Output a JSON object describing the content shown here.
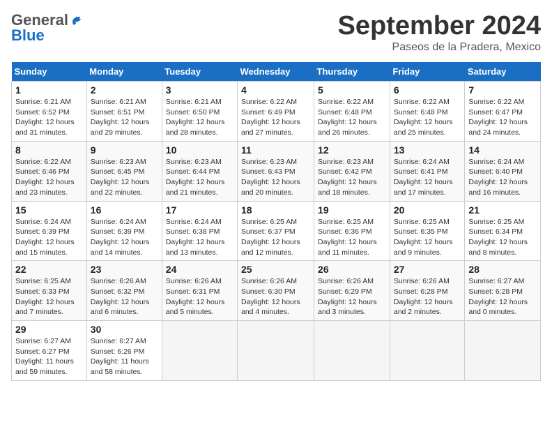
{
  "logo": {
    "general": "General",
    "blue": "Blue"
  },
  "header": {
    "month": "September 2024",
    "location": "Paseos de la Pradera, Mexico"
  },
  "weekdays": [
    "Sunday",
    "Monday",
    "Tuesday",
    "Wednesday",
    "Thursday",
    "Friday",
    "Saturday"
  ],
  "weeks": [
    [
      {
        "day": "1",
        "detail": "Sunrise: 6:21 AM\nSunset: 6:52 PM\nDaylight: 12 hours\nand 31 minutes."
      },
      {
        "day": "2",
        "detail": "Sunrise: 6:21 AM\nSunset: 6:51 PM\nDaylight: 12 hours\nand 29 minutes."
      },
      {
        "day": "3",
        "detail": "Sunrise: 6:21 AM\nSunset: 6:50 PM\nDaylight: 12 hours\nand 28 minutes."
      },
      {
        "day": "4",
        "detail": "Sunrise: 6:22 AM\nSunset: 6:49 PM\nDaylight: 12 hours\nand 27 minutes."
      },
      {
        "day": "5",
        "detail": "Sunrise: 6:22 AM\nSunset: 6:48 PM\nDaylight: 12 hours\nand 26 minutes."
      },
      {
        "day": "6",
        "detail": "Sunrise: 6:22 AM\nSunset: 6:48 PM\nDaylight: 12 hours\nand 25 minutes."
      },
      {
        "day": "7",
        "detail": "Sunrise: 6:22 AM\nSunset: 6:47 PM\nDaylight: 12 hours\nand 24 minutes."
      }
    ],
    [
      {
        "day": "8",
        "detail": "Sunrise: 6:22 AM\nSunset: 6:46 PM\nDaylight: 12 hours\nand 23 minutes."
      },
      {
        "day": "9",
        "detail": "Sunrise: 6:23 AM\nSunset: 6:45 PM\nDaylight: 12 hours\nand 22 minutes."
      },
      {
        "day": "10",
        "detail": "Sunrise: 6:23 AM\nSunset: 6:44 PM\nDaylight: 12 hours\nand 21 minutes."
      },
      {
        "day": "11",
        "detail": "Sunrise: 6:23 AM\nSunset: 6:43 PM\nDaylight: 12 hours\nand 20 minutes."
      },
      {
        "day": "12",
        "detail": "Sunrise: 6:23 AM\nSunset: 6:42 PM\nDaylight: 12 hours\nand 18 minutes."
      },
      {
        "day": "13",
        "detail": "Sunrise: 6:24 AM\nSunset: 6:41 PM\nDaylight: 12 hours\nand 17 minutes."
      },
      {
        "day": "14",
        "detail": "Sunrise: 6:24 AM\nSunset: 6:40 PM\nDaylight: 12 hours\nand 16 minutes."
      }
    ],
    [
      {
        "day": "15",
        "detail": "Sunrise: 6:24 AM\nSunset: 6:39 PM\nDaylight: 12 hours\nand 15 minutes."
      },
      {
        "day": "16",
        "detail": "Sunrise: 6:24 AM\nSunset: 6:39 PM\nDaylight: 12 hours\nand 14 minutes."
      },
      {
        "day": "17",
        "detail": "Sunrise: 6:24 AM\nSunset: 6:38 PM\nDaylight: 12 hours\nand 13 minutes."
      },
      {
        "day": "18",
        "detail": "Sunrise: 6:25 AM\nSunset: 6:37 PM\nDaylight: 12 hours\nand 12 minutes."
      },
      {
        "day": "19",
        "detail": "Sunrise: 6:25 AM\nSunset: 6:36 PM\nDaylight: 12 hours\nand 11 minutes."
      },
      {
        "day": "20",
        "detail": "Sunrise: 6:25 AM\nSunset: 6:35 PM\nDaylight: 12 hours\nand 9 minutes."
      },
      {
        "day": "21",
        "detail": "Sunrise: 6:25 AM\nSunset: 6:34 PM\nDaylight: 12 hours\nand 8 minutes."
      }
    ],
    [
      {
        "day": "22",
        "detail": "Sunrise: 6:25 AM\nSunset: 6:33 PM\nDaylight: 12 hours\nand 7 minutes."
      },
      {
        "day": "23",
        "detail": "Sunrise: 6:26 AM\nSunset: 6:32 PM\nDaylight: 12 hours\nand 6 minutes."
      },
      {
        "day": "24",
        "detail": "Sunrise: 6:26 AM\nSunset: 6:31 PM\nDaylight: 12 hours\nand 5 minutes."
      },
      {
        "day": "25",
        "detail": "Sunrise: 6:26 AM\nSunset: 6:30 PM\nDaylight: 12 hours\nand 4 minutes."
      },
      {
        "day": "26",
        "detail": "Sunrise: 6:26 AM\nSunset: 6:29 PM\nDaylight: 12 hours\nand 3 minutes."
      },
      {
        "day": "27",
        "detail": "Sunrise: 6:26 AM\nSunset: 6:28 PM\nDaylight: 12 hours\nand 2 minutes."
      },
      {
        "day": "28",
        "detail": "Sunrise: 6:27 AM\nSunset: 6:28 PM\nDaylight: 12 hours\nand 0 minutes."
      }
    ],
    [
      {
        "day": "29",
        "detail": "Sunrise: 6:27 AM\nSunset: 6:27 PM\nDaylight: 11 hours\nand 59 minutes."
      },
      {
        "day": "30",
        "detail": "Sunrise: 6:27 AM\nSunset: 6:26 PM\nDaylight: 11 hours\nand 58 minutes."
      },
      {
        "day": "",
        "detail": "",
        "empty": true
      },
      {
        "day": "",
        "detail": "",
        "empty": true
      },
      {
        "day": "",
        "detail": "",
        "empty": true
      },
      {
        "day": "",
        "detail": "",
        "empty": true
      },
      {
        "day": "",
        "detail": "",
        "empty": true
      }
    ]
  ]
}
